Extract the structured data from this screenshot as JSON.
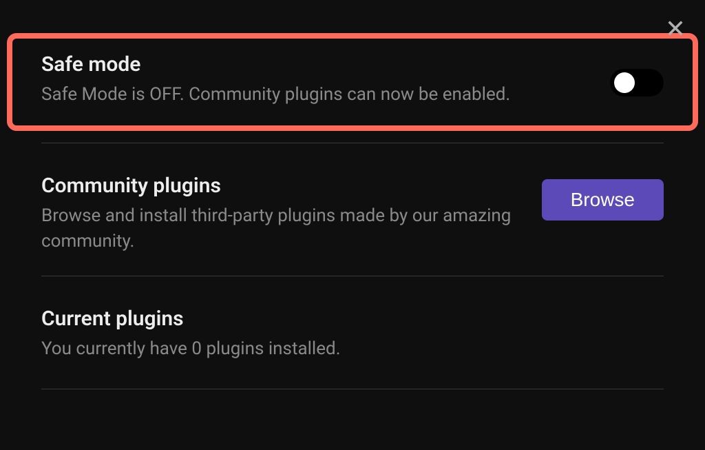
{
  "close": {
    "glyph": "✕"
  },
  "sections": {
    "safeMode": {
      "title": "Safe mode",
      "description": "Safe Mode is OFF. Community plugins can now be enabled.",
      "toggleState": "off"
    },
    "communityPlugins": {
      "title": "Community plugins",
      "description": "Browse and install third-party plugins made by our amazing community.",
      "buttonLabel": "Browse"
    },
    "currentPlugins": {
      "title": "Current plugins",
      "description": "You currently have 0 plugins installed."
    }
  },
  "colors": {
    "highlight": "#ff6b5b",
    "accent": "#5b4ab8",
    "background": "#0f0f0f"
  }
}
